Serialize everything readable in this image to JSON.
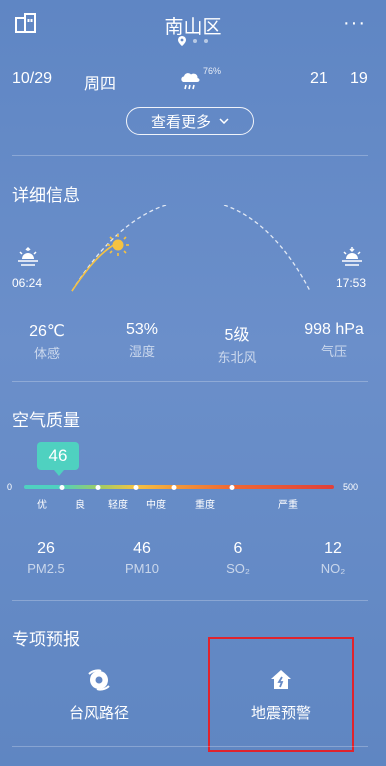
{
  "header": {
    "title": "南山区",
    "menu_label": "···"
  },
  "forecast": {
    "date": "10/29",
    "weekday": "周四",
    "rain_chance": "76%",
    "high": "21",
    "low": "19"
  },
  "more_button": {
    "label": "查看更多"
  },
  "details": {
    "title": "详细信息",
    "sunrise": "06:24",
    "sunset": "17:53",
    "stats": [
      {
        "value": "26℃",
        "label": "体感"
      },
      {
        "value": "53%",
        "label": "湿度"
      },
      {
        "value": "5级",
        "label": "东北风"
      },
      {
        "value": "998 hPa",
        "label": "气压"
      }
    ]
  },
  "air_quality": {
    "title": "空气质量",
    "aqi": "46",
    "aqi_value": 46,
    "scale_min": "0",
    "scale_max": "500",
    "levels": [
      "优",
      "良",
      "轻度",
      "中度",
      "重度",
      "严重"
    ],
    "level_colors": [
      "#4fd1c0",
      "#9ccc65",
      "#f5c242",
      "#f29b38",
      "#ef6a34",
      "#e0403a"
    ],
    "pollutants": [
      {
        "value": "26",
        "label": "PM2.5"
      },
      {
        "value": "46",
        "label": "PM10"
      },
      {
        "value": "6",
        "label": "SO₂"
      },
      {
        "value": "12",
        "label": "NO₂"
      }
    ]
  },
  "special": {
    "title": "专项预报",
    "items": [
      {
        "label": "台风路径",
        "icon": "typhoon-icon"
      },
      {
        "label": "地震预警",
        "icon": "earthquake-house-icon"
      }
    ]
  },
  "colors": {
    "background": "#6589c6",
    "highlight_box": "#e0232d",
    "sun": "#f5c242"
  }
}
